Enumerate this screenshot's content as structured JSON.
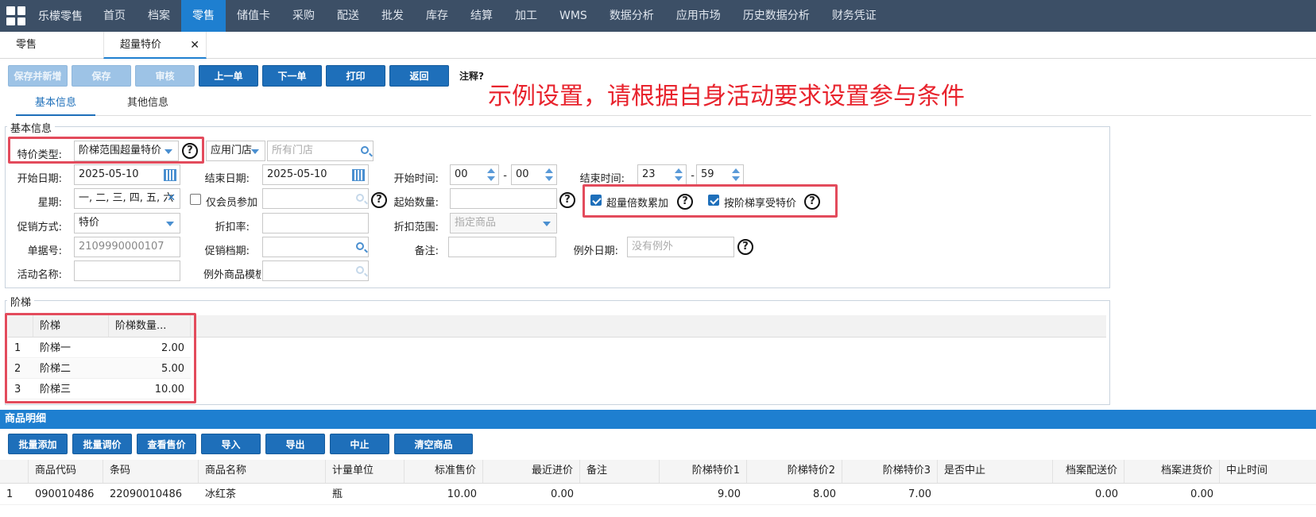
{
  "topnav": {
    "brand": "乐檬零售",
    "items": [
      "首页",
      "档案",
      "零售",
      "储值卡",
      "采购",
      "配送",
      "批发",
      "库存",
      "结算",
      "加工",
      "WMS",
      "数据分析",
      "应用市场",
      "历史数据分析",
      "财务凭证"
    ],
    "active_index": 2
  },
  "tabs": {
    "t1": "零售",
    "t2": "超量特价",
    "close": "✕"
  },
  "toolbar": {
    "save_new": "保存并新增",
    "save": "保存",
    "audit": "审核",
    "prev": "上一单",
    "next": "下一单",
    "print": "打印",
    "back": "返回",
    "note": "注释?"
  },
  "annotation": "示例设置，请根据自身活动要求设置参与条件",
  "subtabs": {
    "basic": "基本信息",
    "other": "其他信息"
  },
  "basic": {
    "legend": "基本信息",
    "price_type_label": "特价类型:",
    "price_type_value": "阶梯范围超量特价",
    "store_label": "应用门店",
    "store_placeholder": "所有门店",
    "start_date_label": "开始日期:",
    "start_date": "2025-05-10",
    "end_date_label": "结束日期:",
    "end_date": "2025-05-10",
    "start_time_label": "开始时间:",
    "start_hour": "00",
    "start_min": "00",
    "end_time_label": "结束时间:",
    "end_hour": "23",
    "end_min": "59",
    "dash": "-",
    "week_label": "星期:",
    "week_value": "一, 二, 三, 四, 五, 六",
    "member_only_label": "仅会员参加",
    "start_qty_label": "起始数量:",
    "multi_accum_label": "超量倍数累加",
    "tier_price_label": "按阶梯享受特价",
    "promo_mode_label": "促销方式:",
    "promo_mode_value": "特价",
    "discount_rate_label": "折扣率:",
    "discount_range_label": "折扣范围:",
    "discount_range_value": "指定商品",
    "doc_no_label": "单据号:",
    "doc_no": "2109990000107",
    "promo_level_label": "促销档期:",
    "remark_label": "备注:",
    "except_date_label": "例外日期:",
    "except_date_placeholder": "没有例外",
    "activity_name_label": "活动名称:",
    "except_goods_label": "例外商品模板:",
    "help": "?"
  },
  "tiers": {
    "legend": "阶梯",
    "headers": [
      "阶梯",
      "阶梯数量..."
    ],
    "rows": [
      {
        "no": "1",
        "name": "阶梯一",
        "qty": "2.00"
      },
      {
        "no": "2",
        "name": "阶梯二",
        "qty": "5.00"
      },
      {
        "no": "3",
        "name": "阶梯三",
        "qty": "10.00"
      }
    ]
  },
  "goods": {
    "bar_title": "商品明细",
    "buttons": [
      "批量添加",
      "批量调价",
      "查看售价",
      "导入",
      "导出",
      "中止",
      "清空商品"
    ],
    "headers": [
      "商品代码",
      "条码",
      "商品名称",
      "计量单位",
      "标准售价",
      "最近进价",
      "备注",
      "阶梯特价1",
      "阶梯特价2",
      "阶梯特价3",
      "是否中止",
      "档案配送价",
      "档案进货价",
      "中止时间"
    ],
    "rows": [
      {
        "no": "1",
        "code": "090010486",
        "barcode": "22090010486",
        "name": "冰红茶",
        "unit": "瓶",
        "std_price": "10.00",
        "last_cost": "0.00",
        "remark": "",
        "tier1": "9.00",
        "tier2": "8.00",
        "tier3": "7.00",
        "stopped": "",
        "dist_price": "0.00",
        "purchase_price": "0.00",
        "stop_time": ""
      }
    ]
  },
  "colors": {
    "nav_bg": "#3c4f66",
    "accent": "#1e7fd0",
    "button": "#1e6fba",
    "highlight_red": "#e34b5c",
    "annotation_red": "#e8232d"
  }
}
